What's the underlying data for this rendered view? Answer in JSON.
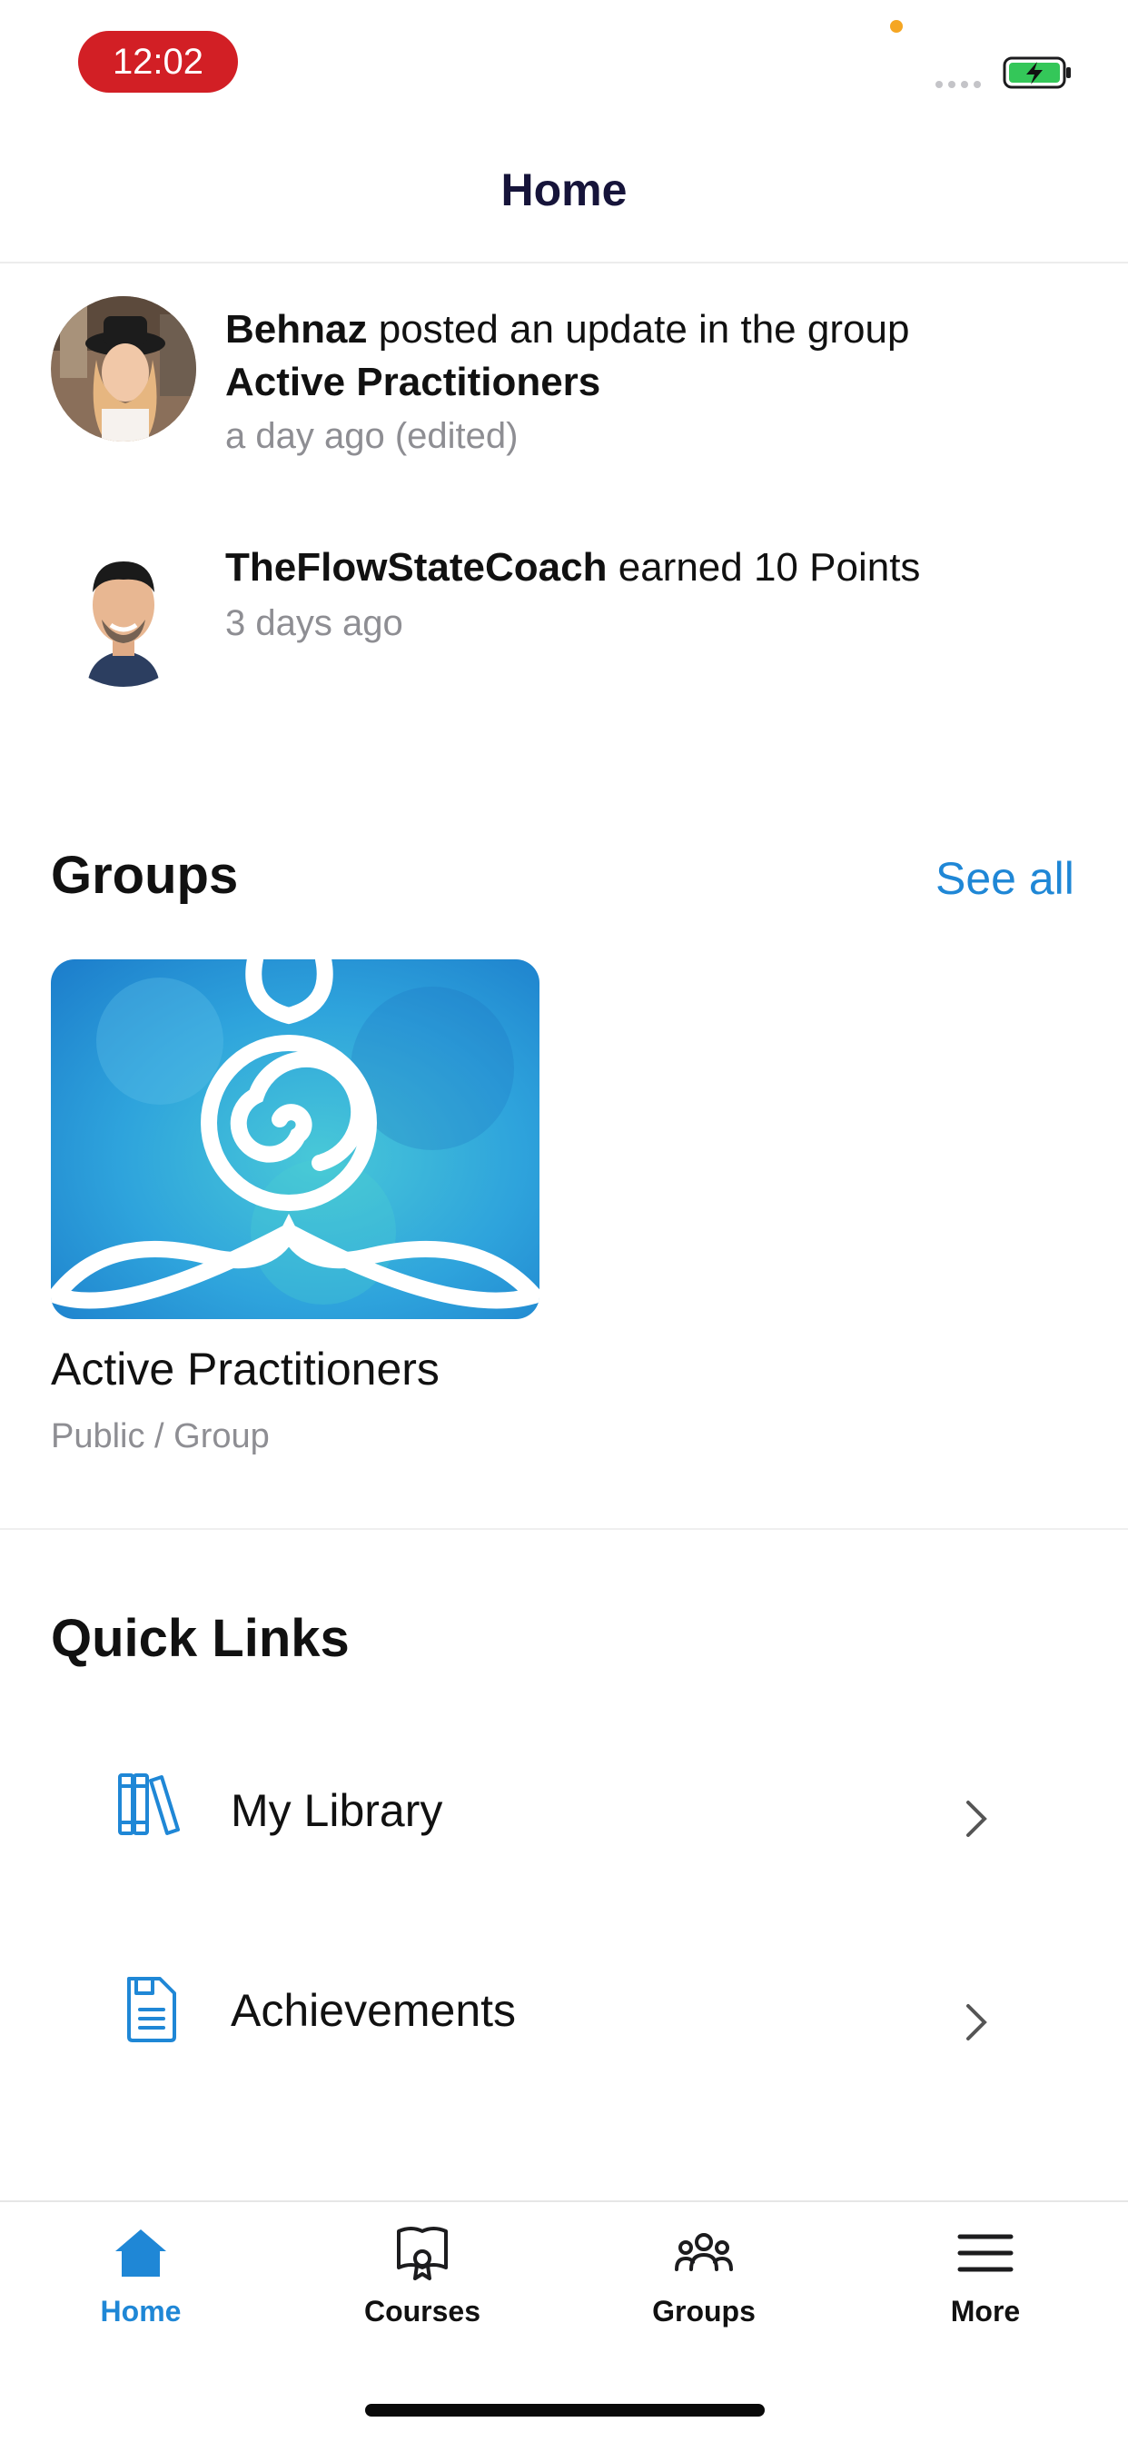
{
  "status_bar": {
    "time": "12:02"
  },
  "header": {
    "title": "Home"
  },
  "activity": [
    {
      "user": "Behnaz",
      "action": "posted an update in the group",
      "target": "Active Practitioners",
      "time": "a day ago (edited)"
    },
    {
      "user": "TheFlowStateCoach",
      "action": "earned 10 Points",
      "time": "3 days ago"
    }
  ],
  "groups": {
    "title": "Groups",
    "see_all": "See all",
    "items": [
      {
        "name": "Active Practitioners",
        "meta": "Public / Group"
      }
    ]
  },
  "quick_links": {
    "title": "Quick Links",
    "items": [
      {
        "label": "My Library",
        "icon": "books-icon"
      },
      {
        "label": "Achievements",
        "icon": "document-icon"
      }
    ]
  },
  "tab_bar": {
    "items": [
      {
        "label": "Home",
        "icon": "home-icon",
        "active": true
      },
      {
        "label": "Courses",
        "icon": "courses-icon",
        "active": false
      },
      {
        "label": "Groups",
        "icon": "groups-icon",
        "active": false
      },
      {
        "label": "More",
        "icon": "menu-icon",
        "active": false
      }
    ]
  },
  "colors": {
    "accent": "#1f87d6",
    "status_pill": "#d21f25",
    "title": "#16143a"
  }
}
